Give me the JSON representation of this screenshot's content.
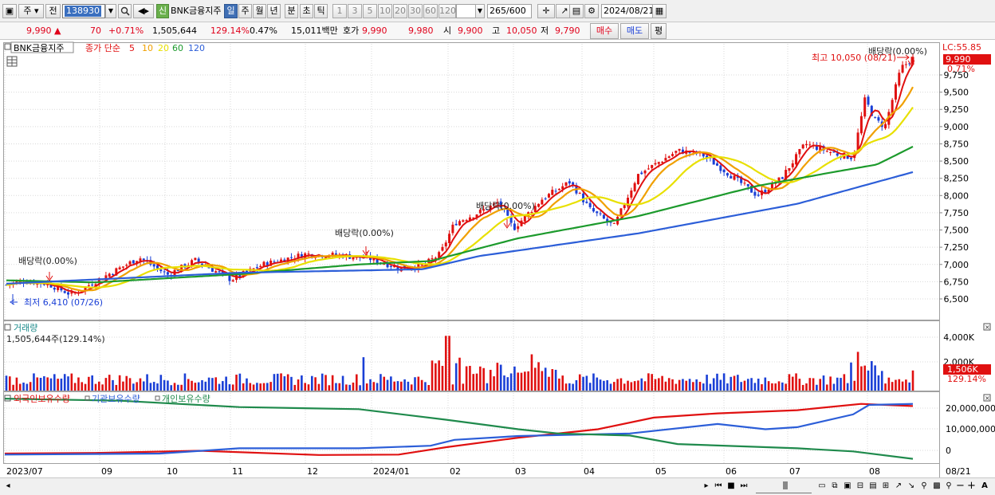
{
  "toolbar": {
    "type_label": "주",
    "prev_label": "전",
    "stock_code": "138930",
    "stock_name": "BNK금융지주",
    "new_badge": "신",
    "periods": [
      "일",
      "주",
      "월",
      "년",
      "분",
      "초",
      "틱"
    ],
    "active_period": "일",
    "intervals": [
      "1",
      "3",
      "5",
      "10",
      "20",
      "30",
      "60",
      "120"
    ],
    "count": "265",
    "count_total": "/600",
    "date": "2024/08/21"
  },
  "quote": {
    "price": "9,990",
    "arrow": "▲",
    "change": "70",
    "change_pct": "+0.71%",
    "volume": "1,505,644",
    "volume_ratio": "129.14%",
    "turnover": "0.47%",
    "amount": "15,011백만",
    "hoga_label": "호가",
    "ask": "9,990",
    "bid": "9,980",
    "open_label": "시",
    "open": "9,900",
    "high_label": "고",
    "high": "10,050",
    "low_label": "저",
    "low": "9,790",
    "buy_label": "매수",
    "sell_label": "매도",
    "fund_label": "평"
  },
  "legend": {
    "name": "BNK금융지주",
    "desc": "종가 단순",
    "ma": [
      {
        "label": "5",
        "color": "#e01010"
      },
      {
        "label": "10",
        "color": "#f0a000"
      },
      {
        "label": "20",
        "color": "#e8e000"
      },
      {
        "label": "60",
        "color": "#1c9a2c"
      },
      {
        "label": "120",
        "color": "#2c5ed8"
      }
    ]
  },
  "annotations": {
    "div1": "배당락(0.00%)",
    "div2": "배당락(0.00%)",
    "div3": "배당락(0.00%)",
    "div4": "배당락(0.00%)",
    "low": "최저 6,410 (07/26)",
    "high": "최고 10,050 (08/21)"
  },
  "price_axis": {
    "lc": "LC:55.85",
    "ticks": [
      "9,750",
      "9,500",
      "9,250",
      "9,000",
      "8,750",
      "8,500",
      "8,250",
      "8,000",
      "7,750",
      "7,500",
      "7,250",
      "7,000",
      "6,750",
      "6,500"
    ],
    "last_price": "9,990",
    "last_pct": "0.71%"
  },
  "volume_panel": {
    "title": "거래량",
    "info": "1,505,644주(129.14%)",
    "ticks": [
      "4,000K",
      "2,000K"
    ],
    "last": "1,506K",
    "last_pct": "129.14%"
  },
  "holding_panel": {
    "series": [
      {
        "name": "외국인보유수량",
        "color": "#e01010"
      },
      {
        "name": "기관보유수량",
        "color": "#2c5ed8"
      },
      {
        "name": "개인보유수량",
        "color": "#1f8a4c"
      }
    ],
    "ticks": [
      "20,000,000",
      "10,000,000",
      "0"
    ]
  },
  "x_axis": {
    "labels": [
      "2023/07",
      "09",
      "10",
      "11",
      "12",
      "2024/01",
      "02",
      "03",
      "04",
      "05",
      "06",
      "07",
      "08"
    ],
    "end_label": "08/21"
  },
  "colors": {
    "up": "#e01010",
    "down": "#1a3fd6",
    "grid": "#d9d9d9",
    "frame": "#a0a0a0"
  }
}
